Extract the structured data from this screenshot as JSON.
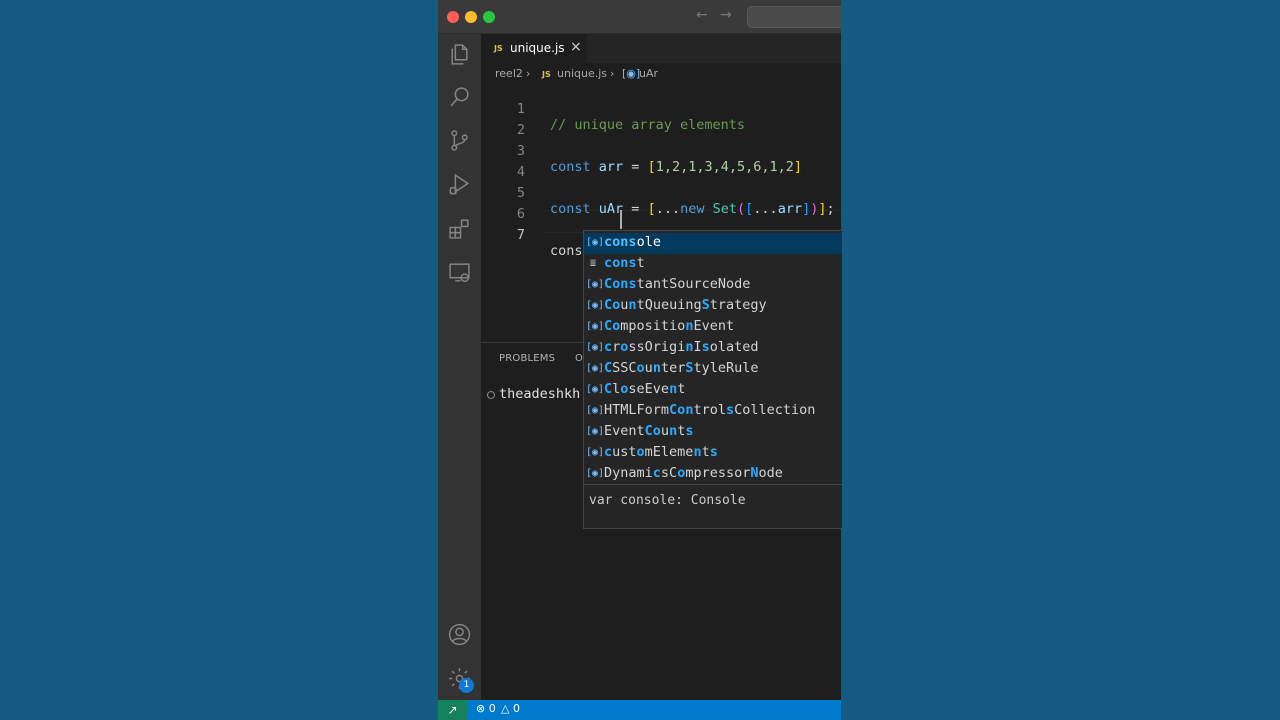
{
  "editor": {
    "tab": {
      "label": "unique.js",
      "file_type": "JS"
    },
    "breadcrumb": {
      "folder": "reel2",
      "file": "unique.js",
      "symbol": "uAr"
    },
    "current_line": 7,
    "line_numbers": [
      "1",
      "2",
      "3",
      "4",
      "5",
      "6",
      "7"
    ],
    "lines": {
      "l1": {
        "comment": "// unique array elements"
      },
      "l3": {
        "kw": "const",
        "name": "arr",
        "eq": " = ",
        "open": "[",
        "nums": "1,2,1,3,4,5,6,1,2",
        "close": "]"
      },
      "l5": {
        "kw": "const",
        "name": "uAr",
        "eq": " = ",
        "open1": "[",
        "spread1": "...",
        "new": "new",
        "cls": "Set",
        "open2": "(",
        "open3": "[",
        "spread2": "...",
        "arg": "arr",
        "close3": "]",
        "close2": ")",
        "close1": "]",
        "semi": ";"
      },
      "l7": {
        "typed": "cons"
      }
    }
  },
  "panel": {
    "tabs": [
      "PROBLEMS",
      "O"
    ],
    "terminal_prompt": "theadeshkh"
  },
  "suggestions": {
    "selected_index": 0,
    "items": [
      {
        "kind": "variable",
        "label": "console"
      },
      {
        "kind": "keyword",
        "label": "const"
      },
      {
        "kind": "variable",
        "label": "ConstantSourceNode"
      },
      {
        "kind": "variable",
        "label": "CountQueuingStrategy"
      },
      {
        "kind": "variable",
        "label": "CompositionEvent"
      },
      {
        "kind": "variable",
        "label": "crossOriginIsolated"
      },
      {
        "kind": "variable",
        "label": "CSSCounterStyleRule"
      },
      {
        "kind": "variable",
        "label": "CloseEvent"
      },
      {
        "kind": "variable",
        "label": "HTMLFormControlsCollection"
      },
      {
        "kind": "variable",
        "label": "EventCounts"
      },
      {
        "kind": "variable",
        "label": "customElements"
      },
      {
        "kind": "variable",
        "label": "DynamicsCompressorNode"
      }
    ],
    "detail": "var console: Console"
  },
  "activity_bar": {
    "icons": [
      "files-icon",
      "search-icon",
      "source-control-icon",
      "run-debug-icon",
      "extensions-icon",
      "remote-explorer-icon"
    ],
    "bottom_icons": [
      "account-icon",
      "settings-gear-icon"
    ],
    "settings_badge": "1"
  },
  "status_bar": {
    "errors": "0",
    "warnings": "0"
  },
  "colors": {
    "accent": "#007acc",
    "remote": "#16825d",
    "selection": "#04395e"
  }
}
